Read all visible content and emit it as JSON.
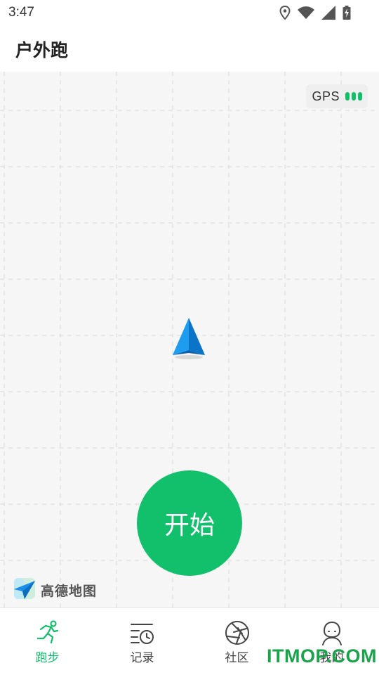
{
  "status_bar": {
    "time": "3:47",
    "icons": [
      "location-pin-icon",
      "wifi-icon",
      "signal-icon",
      "battery-charging-icon"
    ]
  },
  "header": {
    "title": "户外跑"
  },
  "map": {
    "gps_label": "GPS",
    "gps_signal_bars": 3,
    "start_label": "开始",
    "brand_text": "高德地图",
    "marker_icon": "navigation-arrow-icon"
  },
  "bottom_nav": {
    "items": [
      {
        "label": "跑步",
        "icon": "runner-icon",
        "active": true
      },
      {
        "label": "记录",
        "icon": "records-clock-icon",
        "active": false
      },
      {
        "label": "社区",
        "icon": "community-aperture-icon",
        "active": false
      },
      {
        "label": "我的",
        "icon": "profile-person-icon",
        "active": false
      }
    ]
  },
  "watermark": "ITMOP.COM",
  "colors": {
    "accent": "#12bf6b",
    "map_bg": "#f6f6f6",
    "marker": "#1e90e8"
  }
}
